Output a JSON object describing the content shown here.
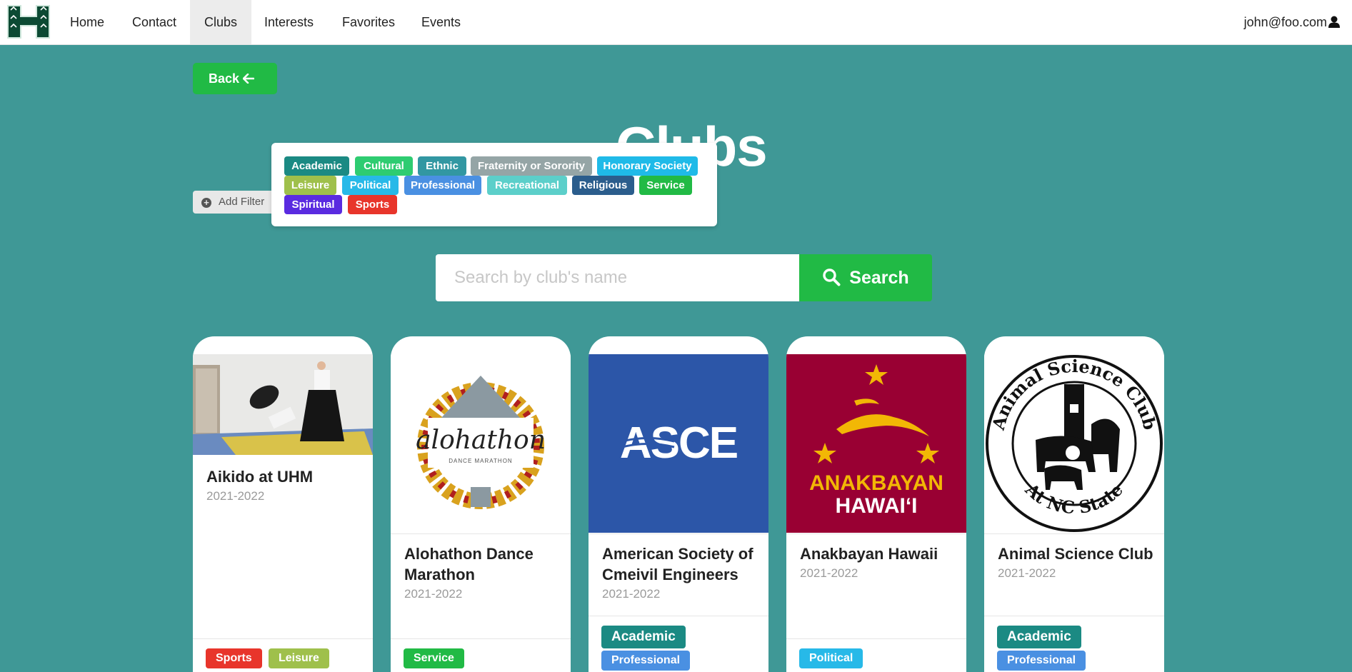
{
  "nav": {
    "items": [
      "Home",
      "Contact",
      "Clubs",
      "Interests",
      "Favorites",
      "Events"
    ],
    "active": "Clubs",
    "user_email": "john@foo.com"
  },
  "back_label": "Back",
  "page_title": "Clubs",
  "add_filter_label": "Add Filter",
  "filters": [
    {
      "label": "Academic",
      "color": "#1b8a83"
    },
    {
      "label": "Cultural",
      "color": "#2ecc71"
    },
    {
      "label": "Ethnic",
      "color": "#3297a2"
    },
    {
      "label": "Fraternity or Sorority",
      "color": "#95a5a6"
    },
    {
      "label": "Honorary Society",
      "color": "#1fbae8"
    },
    {
      "label": "Leisure",
      "color": "#9fc04b"
    },
    {
      "label": "Political",
      "color": "#27b9e8"
    },
    {
      "label": "Professional",
      "color": "#4a90e2"
    },
    {
      "label": "Recreational",
      "color": "#5ccfca"
    },
    {
      "label": "Religious",
      "color": "#2b5d8c"
    },
    {
      "label": "Service",
      "color": "#21ba45"
    },
    {
      "label": "Spiritual",
      "color": "#5a2be0"
    },
    {
      "label": "Sports",
      "color": "#e8352b"
    }
  ],
  "search": {
    "placeholder": "Search by club's name",
    "button_label": "Search"
  },
  "clubs": [
    {
      "name": "Aikido at UHM",
      "year": "2021-2022",
      "tags": [
        "Sports",
        "Leisure"
      ]
    },
    {
      "name": "Alohathon Dance Marathon",
      "year": "2021-2022",
      "tags": [
        "Service"
      ]
    },
    {
      "name": "American Society of Cmeivil Engineers",
      "year": "2021-2022",
      "tags": [
        "Academic",
        "Professional"
      ]
    },
    {
      "name": "Anakbayan Hawaii",
      "year": "2021-2022",
      "tags": [
        "Political"
      ]
    },
    {
      "name": "Animal Science Club",
      "year": "2021-2022",
      "tags": [
        "Academic",
        "Professional"
      ]
    }
  ],
  "logos": {
    "alohathon_word": "alohathon",
    "alohathon_sub": "DANCE MARATHON",
    "asce_word": "ASCE",
    "anakbayan_line1": "ANAKBAYAN",
    "anakbayan_line2": "HAWAI‘I",
    "animal_ring_top": "Animal Science Club",
    "animal_ring_bottom": "At NC State"
  },
  "colors": {
    "background": "#3f9896",
    "accent_green": "#21ba45",
    "asce_blue": "#2c56a8",
    "anakbayan_red": "#990033",
    "logo_green": "#0c4a33"
  }
}
